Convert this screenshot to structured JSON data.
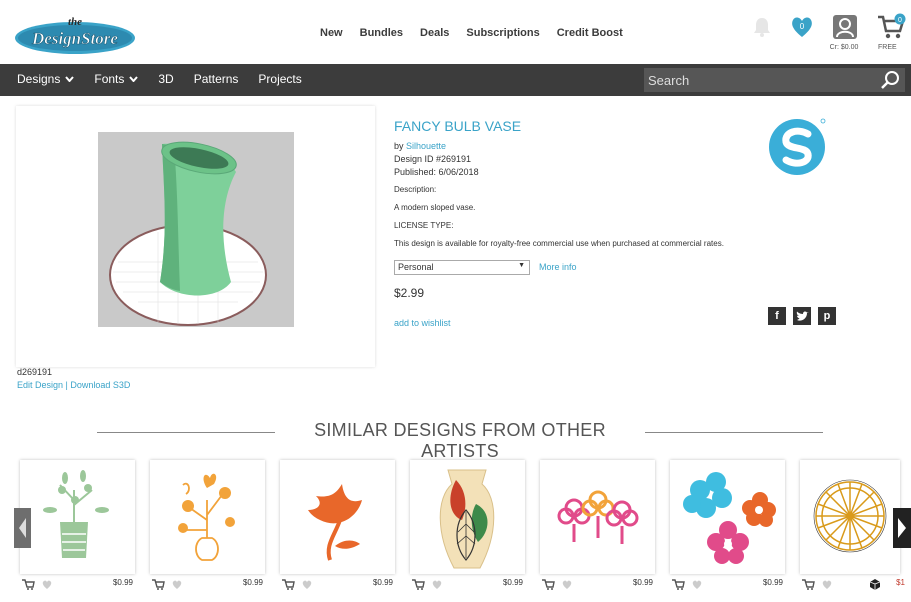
{
  "header": {
    "logo_the": "the",
    "logo_text": "DesignStore",
    "nav": [
      "New",
      "Bundles",
      "Deals",
      "Subscriptions",
      "Credit Boost"
    ],
    "wishlist_count": "0",
    "cart_count": "0",
    "credit": "Cr: $0.00",
    "cart_label": "FREE"
  },
  "catnav": {
    "items": [
      "Designs",
      "Fonts",
      "3D",
      "Patterns",
      "Projects"
    ],
    "search_placeholder": "Search"
  },
  "product": {
    "title": "FANCY BULB VASE",
    "by_prefix": "by ",
    "artist": "Silhouette",
    "design_id": "Design ID #269191",
    "published": "Published: 6/06/2018",
    "description_label": "Description:",
    "description": "A modern sloped vase.",
    "license_label": "LICENSE TYPE:",
    "license_text": "This design is available for royalty-free commercial use when purchased at commercial rates.",
    "license_option": "Personal",
    "more_info": "More info",
    "price": "$2.99",
    "wishlist": "add to wishlist",
    "design_code": "d269191",
    "edit_design": "Edit Design",
    "separator": " | ",
    "download": "Download S3D",
    "social": [
      "f",
      "t",
      "p"
    ]
  },
  "similar": {
    "heading": "SIMILAR DESIGNS FROM OTHER ARTISTS",
    "items": [
      {
        "price": "$0.99",
        "icon": "vase-plant"
      },
      {
        "price": "$0.99",
        "icon": "flower-vase"
      },
      {
        "price": "$0.99",
        "icon": "lotus"
      },
      {
        "price": "$0.99",
        "icon": "leaf-vase"
      },
      {
        "price": "$0.99",
        "icon": "pink-flowers"
      },
      {
        "price": "$0.99",
        "icon": "blue-flowers"
      },
      {
        "price": "$1",
        "icon": "starburst"
      }
    ]
  },
  "colors": {
    "accent": "#3aa3c8",
    "navbar": "#3c3c3c"
  }
}
